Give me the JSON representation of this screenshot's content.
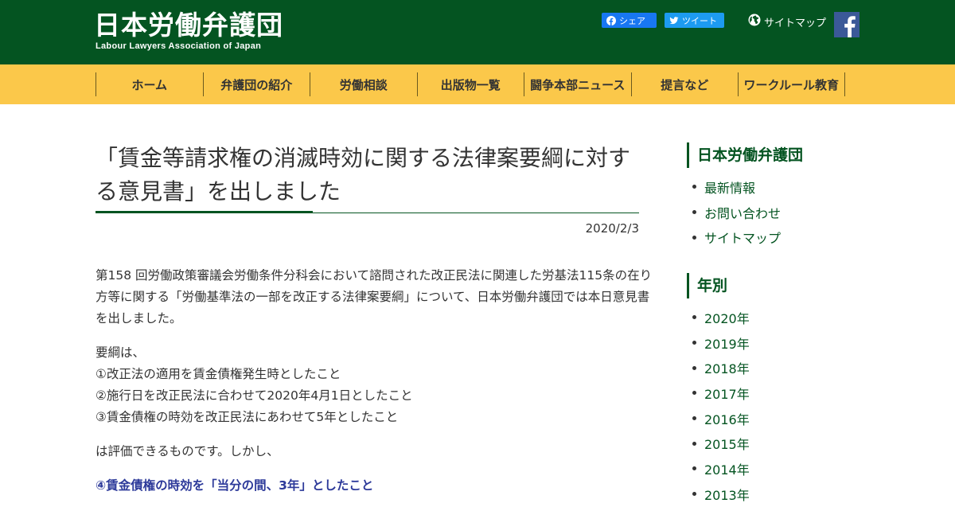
{
  "header": {
    "logo_title": "日本労働弁護団",
    "logo_subtitle": "Labour Lawyers Association of Japan",
    "fb_share_label": "シェア",
    "tweet_label": "ツイート",
    "sitemap_label": "サイトマップ",
    "bg_color": "#045421"
  },
  "nav": {
    "bg_color": "#fbc84a",
    "items": [
      {
        "label": "ホーム"
      },
      {
        "label": "弁護団の紹介"
      },
      {
        "label": "労働相談"
      },
      {
        "label": "出版物一覧"
      },
      {
        "label": "闘争本部ニュース"
      },
      {
        "label": "提言など"
      },
      {
        "label": "ワークルール教育"
      }
    ]
  },
  "article": {
    "title": "「賃金等請求権の消滅時効に関する法律案要綱に対する意見書」を出しました",
    "date": "2020/2/3",
    "para1": "第158 回労働政策審議会労働条件分科会において諮問された改正民法に関連した労基法115条の在り方等に関する「労働基準法の一部を改正する法律案要綱」について、日本労働弁護団では本日意見書を出しました。",
    "para2_lines": [
      "要綱は、",
      "①改正法の適用を賃金債権発生時としたこと",
      "②施行日を改正民法に合わせて2020年4月1日としたこと",
      "③賃金債権の時効を改正民法にあわせて5年としたこと"
    ],
    "para3": "は評価できるものです。しかし、",
    "para4": "④賃金債権の時効を「当分の間、3年」としたこと",
    "highlight_color": "#2d3a9a"
  },
  "sidebar": {
    "heading1": "日本労働弁護団",
    "links": [
      {
        "label": "最新情報"
      },
      {
        "label": "お問い合わせ"
      },
      {
        "label": "サイトマップ"
      }
    ],
    "heading2": "年別",
    "years": [
      {
        "label": "2020年"
      },
      {
        "label": "2019年"
      },
      {
        "label": "2018年"
      },
      {
        "label": "2017年"
      },
      {
        "label": "2016年"
      },
      {
        "label": "2015年"
      },
      {
        "label": "2014年"
      },
      {
        "label": "2013年"
      }
    ]
  }
}
